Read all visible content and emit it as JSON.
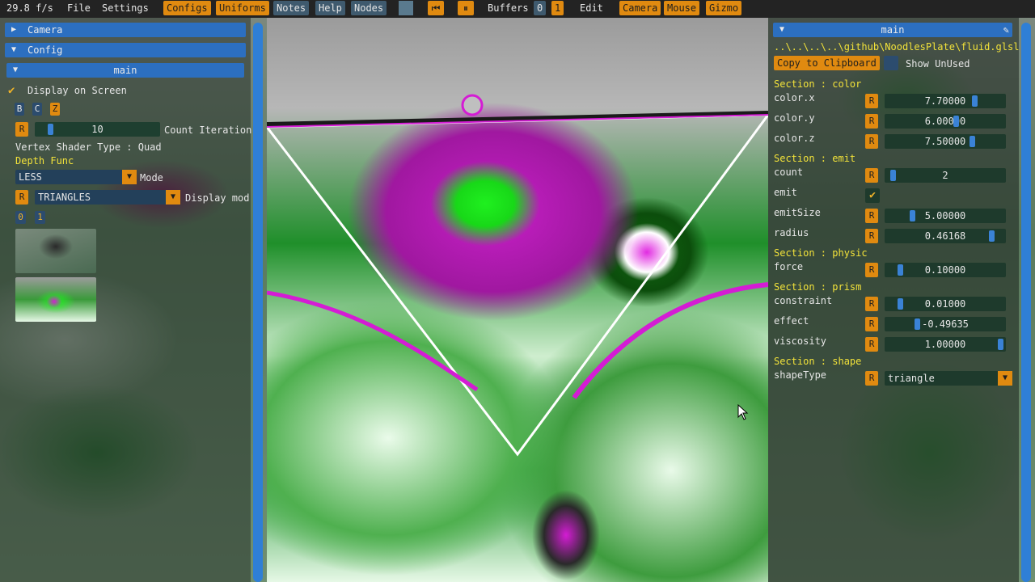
{
  "topbar": {
    "fps": "29.8 f/s",
    "file": "File",
    "settings": "Settings",
    "configs": "Configs",
    "uniforms": "Uniforms",
    "notes": "Notes",
    "help": "Help",
    "nodes": "Nodes",
    "buffers": "Buffers",
    "buffer_0": "0",
    "buffer_1": "1",
    "edit": "Edit",
    "camera": "Camera",
    "mouse": "Mouse",
    "gizmo": "Gizmo"
  },
  "left": {
    "camera_header": "Camera",
    "config_header": "Config",
    "main_header": "main",
    "display_on_screen": "Display on Screen",
    "btn_b": "B",
    "btn_c": "C",
    "btn_z": "Z",
    "reset": "R",
    "count_iteration_value": "10",
    "count_iteration_label": "Count Iteration",
    "vertex_shader_type": "Vertex Shader Type : Quad",
    "depth_func": "Depth Func",
    "depth_mode_value": "LESS",
    "depth_mode_label": "Mode",
    "display_mode_value": "TRIANGLES",
    "display_mode_label": "Display mod",
    "buf_0": "0",
    "buf_1": "1"
  },
  "right": {
    "main_header": "main",
    "path": "..\\..\\..\\..\\github\\NoodlesPlate\\fluid.glsl",
    "copy_clipboard": "Copy to Clipboard",
    "show_unused": "Show UnUsed",
    "reset": "R",
    "sections": {
      "color": "Section : color",
      "emit": "Section : emit",
      "physic": "Section : physic",
      "prism": "Section : prism",
      "shape": "Section : shape"
    },
    "params": {
      "color_x": {
        "label": "color.x",
        "value": "7.70000"
      },
      "color_y": {
        "label": "color.y",
        "value": "6.00000"
      },
      "color_z": {
        "label": "color.z",
        "value": "7.50000"
      },
      "count": {
        "label": "count",
        "value": "2"
      },
      "emit": {
        "label": "emit"
      },
      "emitSize": {
        "label": "emitSize",
        "value": "5.00000"
      },
      "radius": {
        "label": "radius",
        "value": "0.46168"
      },
      "force": {
        "label": "force",
        "value": "0.10000"
      },
      "constraint": {
        "label": "constraint",
        "value": "0.01000"
      },
      "effect": {
        "label": "effect",
        "value": "-0.49635"
      },
      "viscosity": {
        "label": "viscosity",
        "value": "1.00000"
      },
      "shapeType": {
        "label": "shapeType",
        "value": "triangle"
      }
    }
  },
  "colors": {
    "accent_orange": "#e08a10",
    "header_blue": "#2c6fc0",
    "section_yellow": "#f2e23a",
    "magenta": "#c81fc8",
    "green": "#1ff01f"
  }
}
